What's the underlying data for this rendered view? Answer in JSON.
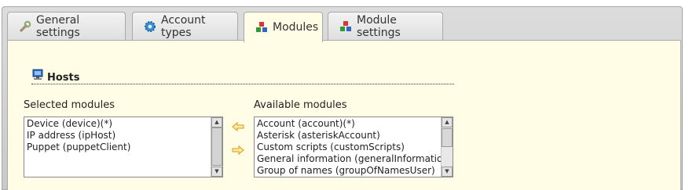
{
  "tabs": [
    {
      "label": "General settings",
      "icon": "wrench-icon"
    },
    {
      "label": "Account types",
      "icon": "gear-icon"
    },
    {
      "label": "Modules",
      "icon": "modules-icon"
    },
    {
      "label": "Module settings",
      "icon": "modules-icon"
    }
  ],
  "active_tab": "Modules",
  "section": {
    "title": "Hosts",
    "icon": "computer-icon"
  },
  "selected": {
    "label": "Selected modules",
    "items": [
      "Device (device)(*)",
      "IP address (ipHost)",
      "Puppet (puppetClient)"
    ]
  },
  "available": {
    "label": "Available modules",
    "items": [
      "Account (account)(*)",
      "Asterisk (asteriskAccount)",
      "Custom scripts (customScripts)",
      "General information (generalInformation)",
      "Group of names (groupOfNamesUser)"
    ]
  },
  "colors": {
    "panel": "#fffde5",
    "arrow": "#f2b320"
  }
}
